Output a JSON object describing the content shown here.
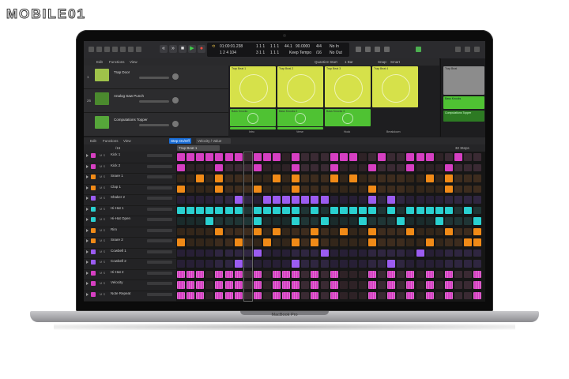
{
  "watermark": {
    "text": "MOBILE01"
  },
  "device": {
    "brand": "MacBook Pro"
  },
  "control_bar": {
    "position_time": "01:00:01.238",
    "position_beats": "1 2 4 104",
    "bar_a": "1 1 1",
    "bar_b": "3 1 1",
    "bar_c": "1 1 1",
    "bar_d": "1 1 1",
    "tempo": "90.0000",
    "tempo_label": "Keep Tempo",
    "tempo_prefix": "44.1",
    "signature": "4/4",
    "signature_label": "/16",
    "in_label": "No In",
    "out_label": "No Out"
  },
  "tracks_menu": {
    "edit": "Edit",
    "functions": "Functions",
    "view": "View",
    "quantize_label": "Quantize Start",
    "quantize_value": "1 Bar",
    "snap": "Snap:",
    "snap_value": "Smart",
    "drag": "Drag:",
    "drag_value": "No Overlap"
  },
  "tracks": [
    {
      "num": "1",
      "name": "Trap Door",
      "color": "#cfe04a"
    },
    {
      "num": "26",
      "name": "Analog Saw Punch",
      "color": "#62c23a"
    },
    {
      "num": "",
      "name": "Computations Topper",
      "color": "#62c23a"
    }
  ],
  "live_cells": {
    "row1": [
      "Trap Beat 1",
      "Trap Beat 2",
      "Trap Beat 3",
      "Trap Beat 4"
    ],
    "row2": [
      "Bass Knocks",
      "Bass Knocks 2",
      "Bass Knocks 3"
    ],
    "row3": [
      "Computations Topper",
      "Computations Topper"
    ],
    "columns": [
      "Intro",
      "Verse",
      "Hook",
      "Breakdown"
    ]
  },
  "editor_regions": {
    "region1": "Trap Beat",
    "region2": "Bass Knocks",
    "region3": "Computations Topper"
  },
  "step_sequencer": {
    "edit": "Edit",
    "functions": "Functions",
    "view": "View",
    "step_onoff": "Step On/Off",
    "velocity": "Velocity / Value",
    "pattern_name": "Trap Beat 1",
    "steps": "32 Steps",
    "rate": "/16",
    "rows": [
      {
        "name": "Kick 1",
        "color": "#d63fc2"
      },
      {
        "name": "Kick 2",
        "color": "#d63fc2"
      },
      {
        "name": "Snare 1",
        "color": "#f08a17"
      },
      {
        "name": "Clap 1",
        "color": "#f08a17"
      },
      {
        "name": "Shaker 2",
        "color": "#9b5cf0"
      },
      {
        "name": "Hi-Hat 1",
        "color": "#2ad0d0"
      },
      {
        "name": "Hi-Hat Open",
        "color": "#2ad0d0"
      },
      {
        "name": "Rim",
        "color": "#f08a17"
      },
      {
        "name": "Snare 2",
        "color": "#f08a17"
      },
      {
        "name": "Cowbell 1",
        "color": "#9b5cf0"
      },
      {
        "name": "Cowbell 2",
        "color": "#9b5cf0"
      },
      {
        "name": "Hi-Hat 2",
        "color": "#d63fc2"
      },
      {
        "name": "Velocity",
        "color": "#d63fc2"
      },
      {
        "name": "Note Repeat",
        "color": "#d63fc2"
      }
    ],
    "ms_label": "M S"
  }
}
